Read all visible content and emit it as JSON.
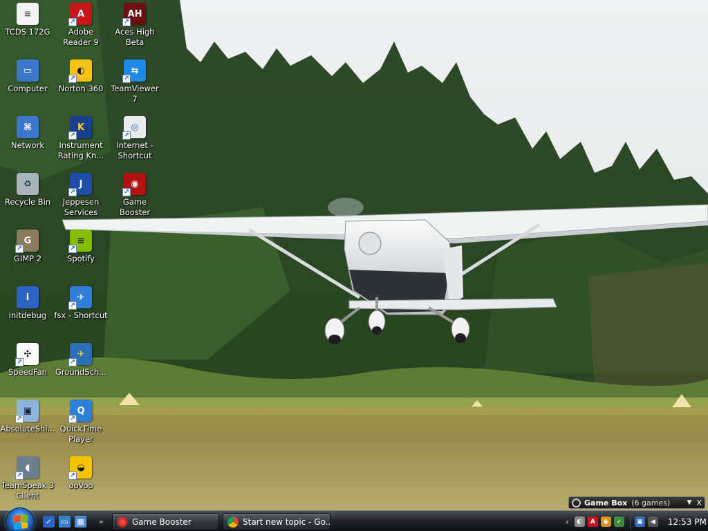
{
  "desktop": {
    "icons": [
      {
        "label": "TCDS 172G",
        "icon": "text-document-icon",
        "color": "#f4f4f4",
        "fg": "#666",
        "glyph": "≡",
        "shortcut": false
      },
      {
        "label": "Adobe Reader 9",
        "icon": "adobe-reader-icon",
        "color": "#c8141b",
        "fg": "#fff",
        "glyph": "A",
        "shortcut": true
      },
      {
        "label": "Aces High Beta",
        "icon": "aces-high-icon",
        "color": "#6a1010",
        "fg": "#fff",
        "glyph": "AH",
        "shortcut": true
      },
      {
        "label": "Computer",
        "icon": "computer-icon",
        "color": "#3d77c9",
        "fg": "#fff",
        "glyph": "▭",
        "shortcut": false
      },
      {
        "label": "Norton 360",
        "icon": "norton-icon",
        "color": "#f4c31a",
        "fg": "#111",
        "glyph": "◐",
        "shortcut": true
      },
      {
        "label": "TeamViewer 7",
        "icon": "teamviewer-icon",
        "color": "#1e88e5",
        "fg": "#fff",
        "glyph": "⇆",
        "shortcut": true
      },
      {
        "label": "Network",
        "icon": "network-icon",
        "color": "#3d77c9",
        "fg": "#fff",
        "glyph": "⌘",
        "shortcut": false
      },
      {
        "label": "Instrument Rating Kn...",
        "icon": "king-schools-icon",
        "color": "#1b3f8f",
        "fg": "#ffd21a",
        "glyph": "K",
        "shortcut": true
      },
      {
        "label": "Internet - Shortcut",
        "icon": "internet-shortcut-icon",
        "color": "#e9ecef",
        "fg": "#1a73e8",
        "glyph": "◎",
        "shortcut": true
      },
      {
        "label": "Recycle Bin",
        "icon": "recycle-bin-icon",
        "color": "#aab4bc",
        "fg": "#244",
        "glyph": "♻",
        "shortcut": false
      },
      {
        "label": "Jeppesen Services",
        "icon": "jeppesen-icon",
        "color": "#1d4ea3",
        "fg": "#fff",
        "glyph": "J",
        "shortcut": true
      },
      {
        "label": "Game Booster",
        "icon": "game-booster-icon",
        "color": "#b31212",
        "fg": "#fff",
        "glyph": "◉",
        "shortcut": true
      },
      {
        "label": "GIMP 2",
        "icon": "gimp-icon",
        "color": "#8a7a5e",
        "fg": "#fff",
        "glyph": "G",
        "shortcut": true
      },
      {
        "label": "Spotify",
        "icon": "spotify-icon",
        "color": "#84bd00",
        "fg": "#111",
        "glyph": "≋",
        "shortcut": true
      },
      {
        "label": "initdebug",
        "icon": "info-file-icon",
        "color": "#2d64c4",
        "fg": "#fff",
        "glyph": "i",
        "shortcut": false
      },
      {
        "label": "fsx - Shortcut",
        "icon": "flight-simulator-icon",
        "color": "#2f7fd8",
        "fg": "#fff",
        "glyph": "✈",
        "shortcut": true
      },
      {
        "label": "SpeedFan",
        "icon": "speedfan-icon",
        "color": "#ffffff",
        "fg": "#111",
        "glyph": "✣",
        "shortcut": true
      },
      {
        "label": "GroundSch...",
        "icon": "ground-school-icon",
        "color": "#2a6fb5",
        "fg": "#ffd21a",
        "glyph": "✈",
        "shortcut": true
      },
      {
        "label": "AbsoluteShi...",
        "icon": "absolute-shield-icon",
        "color": "#8fb3d9",
        "fg": "#123",
        "glyph": "▣",
        "shortcut": true
      },
      {
        "label": "QuickTime Player",
        "icon": "quicktime-icon",
        "color": "#2f7fd8",
        "fg": "#fff",
        "glyph": "Q",
        "shortcut": true
      },
      {
        "label": "TeamSpeak 3 Client",
        "icon": "teamspeak-icon",
        "color": "#6b7f8c",
        "fg": "#fff",
        "glyph": "◖",
        "shortcut": true
      },
      {
        "label": "ooVoo",
        "icon": "oovoo-icon",
        "color": "#f5c400",
        "fg": "#111",
        "glyph": "◒",
        "shortcut": true
      }
    ]
  },
  "gamebox": {
    "title": "Game Box",
    "count": "(6 games)",
    "arrow": "▼",
    "close": "X"
  },
  "taskbar": {
    "start_icon": "windows-start-orb-icon",
    "quick_launch": [
      {
        "icon": "show-desktop-icon",
        "glyph": "✓",
        "color": "#2b64c0"
      },
      {
        "icon": "switch-windows-icon",
        "glyph": "▭",
        "color": "#3a80c8"
      },
      {
        "icon": "desktop-window-icon",
        "glyph": "▦",
        "color": "#4d8ad0"
      }
    ],
    "ql_overflow": "»",
    "tasks": [
      {
        "label": "Game Booster",
        "icon": "game-booster-icon",
        "color": "#c62020"
      },
      {
        "label": "Start new topic - Go...",
        "icon": "chrome-icon",
        "color": "#4caf50"
      }
    ],
    "tray": {
      "chevron": "‹",
      "icons": [
        {
          "icon": "norton-tray-icon",
          "glyph": "◐",
          "color": "#888"
        },
        {
          "icon": "adobe-tray-icon",
          "glyph": "A",
          "color": "#c8141b"
        },
        {
          "icon": "game-booster-tray-icon",
          "glyph": "◉",
          "color": "#d8901a"
        },
        {
          "icon": "shield-tray-icon",
          "glyph": "✓",
          "color": "#3f8a3f"
        },
        {
          "icon": "network-tray-icon",
          "glyph": "▣",
          "color": "#2f6fbf"
        },
        {
          "icon": "volume-icon",
          "glyph": "◀",
          "color": "#555"
        }
      ],
      "clock": "12:53 PM"
    }
  }
}
